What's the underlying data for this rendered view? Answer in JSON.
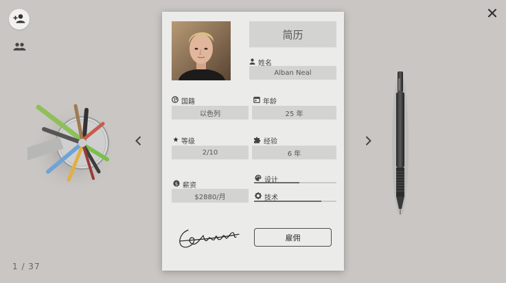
{
  "toolbar": {
    "add_icon": "person-add-icon",
    "group_icon": "group-icon",
    "close_icon": "close-icon"
  },
  "navigation": {
    "prev_icon": "chevron-left-icon",
    "next_icon": "chevron-right-icon",
    "counter": "1 / 37"
  },
  "card": {
    "title": "简历",
    "name": {
      "label": "姓名",
      "value": "Alban Neal",
      "icon": "person-icon"
    },
    "nationality": {
      "label": "国籍",
      "value": "以色列",
      "icon": "globe-icon"
    },
    "age": {
      "label": "年龄",
      "value": "25 年",
      "icon": "calendar-icon"
    },
    "level": {
      "label": "等级",
      "value": "2/10",
      "icon": "star-icon"
    },
    "experience": {
      "label": "经验",
      "value": "6 年",
      "icon": "puzzle-icon"
    },
    "salary": {
      "label": "薪资",
      "value": "$2880/月",
      "icon": "dollar-icon"
    },
    "skills": [
      {
        "label": "设计",
        "icon": "palette-icon",
        "level": 0.55
      },
      {
        "label": "技术",
        "icon": "gear-icon",
        "level": 0.82
      }
    ],
    "hire_button": "雇佣"
  },
  "colors": {
    "background": "#c9c6c3",
    "card": "#ebebe9",
    "field_box": "#d3d3d1"
  }
}
